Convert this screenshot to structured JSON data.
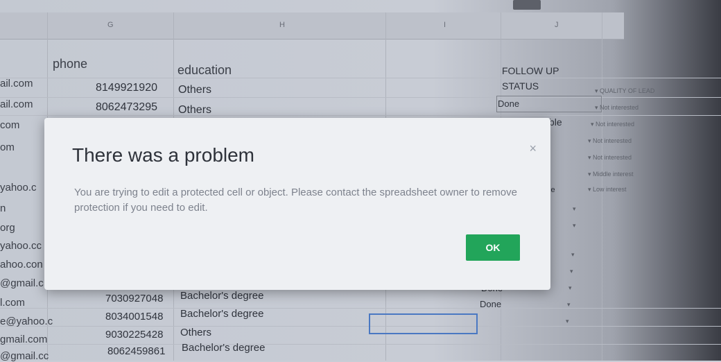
{
  "column_letters": {
    "g": "G",
    "h": "H",
    "i": "I",
    "j": "J"
  },
  "headers": {
    "phone": "phone",
    "education": "education",
    "follow_up": "FOLLOW UP",
    "status": "STATUS"
  },
  "rows_top": [
    {
      "email": "ail.com",
      "phone": "8149921920",
      "education": "Others",
      "status": ""
    },
    {
      "email": "ail.com",
      "phone": "8062473295",
      "education": "Others",
      "status": "Done"
    },
    {
      "email": "com",
      "phone": "",
      "education": "",
      "status": "Not Reachable"
    }
  ],
  "emails_left": [
    "om",
    "",
    "yahoo.c",
    "n",
    "org",
    "yahoo.cc",
    "ahoo.con",
    "@gmail.c"
  ],
  "rows_bottom": [
    {
      "email": "l.com",
      "phone": "7030927048",
      "education": "Bachelor's degree",
      "status": "Done"
    },
    {
      "email": "e@yahoo.c",
      "phone": "8034001548",
      "education": "Bachelor's degree",
      "status": "Done"
    },
    {
      "email": "gmail.com",
      "phone": "9030225428",
      "education": "Others",
      "status": ""
    },
    {
      "email": "@gmail.cc",
      "phone": "8062459861",
      "education": "Bachelor's degree",
      "status": ""
    }
  ],
  "quality_header": "QUALITY OF LEAD",
  "quality_items": [
    "Not interested",
    "Not interested",
    "Not interested",
    "Not interested",
    "Middle interest",
    "Low interest"
  ],
  "partial_status": [
    "ble",
    "ble"
  ],
  "dialog": {
    "title": "There was a problem",
    "message": "You are trying to edit a protected cell or object. Please contact the spreadsheet owner to remove protection if you need to edit.",
    "ok_label": "OK",
    "close_icon": "×"
  }
}
